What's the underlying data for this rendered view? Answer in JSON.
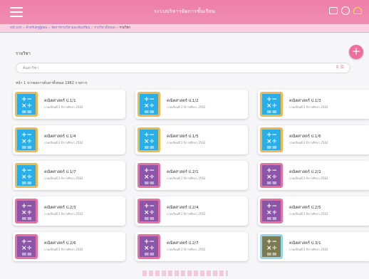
{
  "app": {
    "title": "ระบบบริหารจัดการชั้นเรียน"
  },
  "breadcrumb": [
    "หน้าแรก",
    "สำหรับครูผู้สอน",
    "จัดการรายวิชาและห้องเรียน",
    "รายวิชาทั้งหมด",
    "รายวิชา"
  ],
  "section": {
    "label": "รายวิชา"
  },
  "search": {
    "placeholder": "ค้นหาวิชา"
  },
  "count_text": "หน้า 1 จากผลการค้นหาทั้งหมด 1982 รายการ",
  "cards": [
    {
      "title": "คณิตศาสตร์ ป.1/1",
      "subtitle": "ภาคเรียนที่ 2 ปีการศึกษา 2562",
      "style": "blue"
    },
    {
      "title": "คณิตศาสตร์ ป.1/2",
      "subtitle": "ภาคเรียนที่ 2 ปีการศึกษา 2562",
      "style": "blue"
    },
    {
      "title": "คณิตศาสตร์ ป.1/3",
      "subtitle": "ภาคเรียนที่ 2 ปีการศึกษา 2562",
      "style": "blue"
    },
    {
      "title": "คณิตศาสตร์ ป.1/4",
      "subtitle": "ภาคเรียนที่ 2 ปีการศึกษา 2562",
      "style": "blue"
    },
    {
      "title": "คณิตศาสตร์ ป.1/5",
      "subtitle": "ภาคเรียนที่ 2 ปีการศึกษา 2562",
      "style": "blue"
    },
    {
      "title": "คณิตศาสตร์ ป.1/6",
      "subtitle": "ภาคเรียนที่ 2 ปีการศึกษา 2562",
      "style": "blue"
    },
    {
      "title": "คณิตศาสตร์ ป.1/7",
      "subtitle": "ภาคเรียนที่ 2 ปีการศึกษา 2562",
      "style": "blue"
    },
    {
      "title": "คณิตศาสตร์ ป.2/1",
      "subtitle": "ภาคเรียนที่ 2 ปีการศึกษา 2562",
      "style": "purple"
    },
    {
      "title": "คณิตศาสตร์ ป.2/2",
      "subtitle": "ภาคเรียนที่ 2 ปีการศึกษา 2562",
      "style": "purple"
    },
    {
      "title": "คณิตศาสตร์ ป.2/3",
      "subtitle": "ภาคเรียนที่ 2 ปีการศึกษา 2562",
      "style": "purple"
    },
    {
      "title": "คณิตศาสตร์ ป.2/4",
      "subtitle": "ภาคเรียนที่ 2 ปีการศึกษา 2562",
      "style": "purple"
    },
    {
      "title": "คณิตศาสตร์ ป.2/5",
      "subtitle": "ภาคเรียนที่ 2 ปีการศึกษา 2562",
      "style": "purple"
    },
    {
      "title": "คณิตศาสตร์ ป.2/6",
      "subtitle": "ภาคเรียนที่ 2 ปีการศึกษา 2562",
      "style": "purple"
    },
    {
      "title": "คณิตศาสตร์ ป.2/7",
      "subtitle": "ภาคเรียนที่ 2 ปีการศึกษา 2562",
      "style": "purple"
    },
    {
      "title": "คณิตศาสตร์ ป.3/1",
      "subtitle": "ภาคเรียนที่ 2 ปีการศึกษา 2562",
      "style": "olive"
    }
  ],
  "thumb_glyphs": [
    "+",
    "−",
    "×",
    "÷",
    "=",
    "="
  ],
  "icons": [
    "menu-icon",
    "mail-icon",
    "chat-icon",
    "bell-icon",
    "add-icon",
    "search-icon",
    "filter-icon",
    "calculator-icon"
  ],
  "colors": {
    "topbar": "#ee7fa7",
    "accent": "#ee6e9e",
    "link": "#5b6fd6"
  }
}
